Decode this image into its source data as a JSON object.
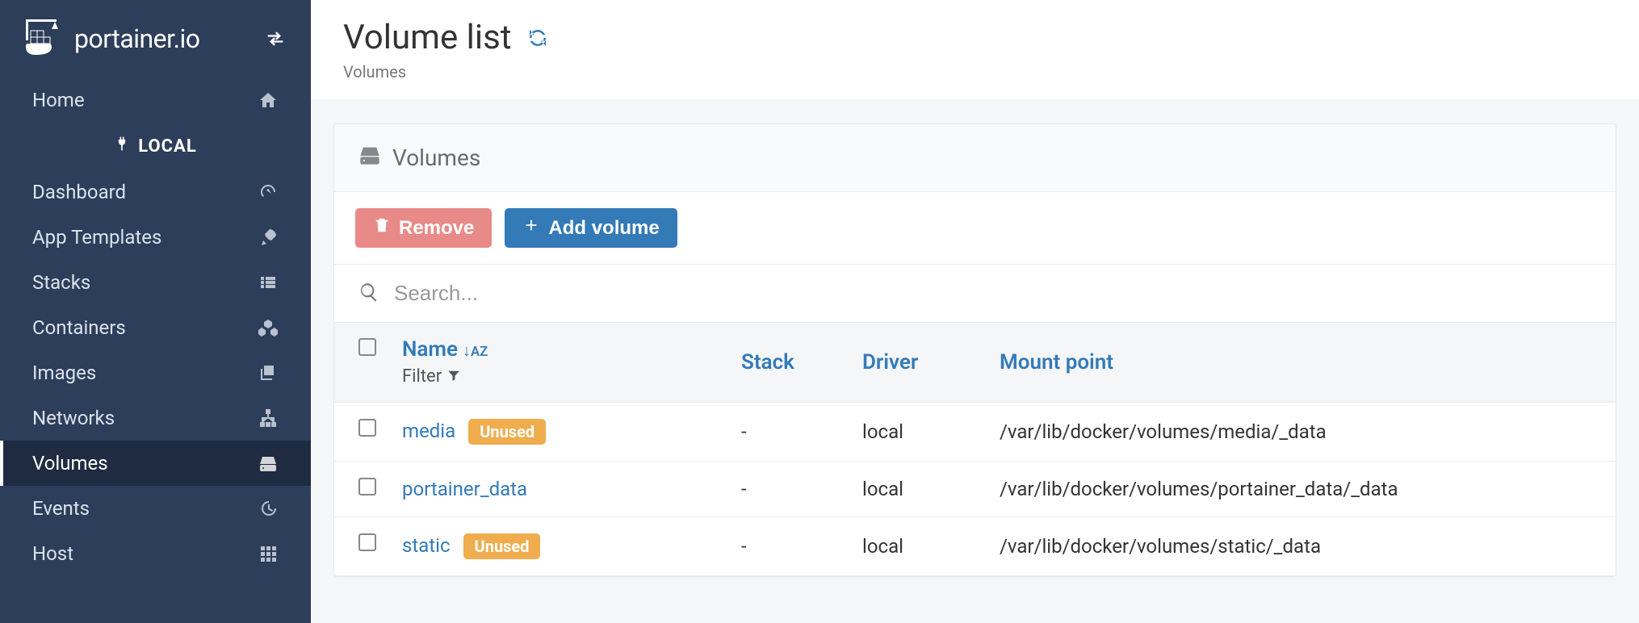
{
  "brand": "portainer.io",
  "sidebar": {
    "header_label": "LOCAL",
    "items": [
      {
        "label": "Home",
        "icon": "home-icon"
      },
      {
        "label": "Dashboard",
        "icon": "dashboard-icon"
      },
      {
        "label": "App Templates",
        "icon": "rocket-icon"
      },
      {
        "label": "Stacks",
        "icon": "list-icon"
      },
      {
        "label": "Containers",
        "icon": "cubes-icon"
      },
      {
        "label": "Images",
        "icon": "clone-icon"
      },
      {
        "label": "Networks",
        "icon": "sitemap-icon"
      },
      {
        "label": "Volumes",
        "icon": "hdd-icon"
      },
      {
        "label": "Events",
        "icon": "history-icon"
      },
      {
        "label": "Host",
        "icon": "th-icon"
      }
    ]
  },
  "page": {
    "title": "Volume list",
    "breadcrumb": "Volumes"
  },
  "card": {
    "title": "Volumes"
  },
  "toolbar": {
    "remove": "Remove",
    "add": "Add volume"
  },
  "search": {
    "placeholder": "Search..."
  },
  "table": {
    "headers": {
      "name": "Name",
      "filter": "Filter",
      "stack": "Stack",
      "driver": "Driver",
      "mount": "Mount point"
    },
    "rows": [
      {
        "name": "media",
        "badge": "Unused",
        "stack": "-",
        "driver": "local",
        "mount": "/var/lib/docker/volumes/media/_data"
      },
      {
        "name": "portainer_data",
        "badge": "",
        "stack": "-",
        "driver": "local",
        "mount": "/var/lib/docker/volumes/portainer_data/_data"
      },
      {
        "name": "static",
        "badge": "Unused",
        "stack": "-",
        "driver": "local",
        "mount": "/var/lib/docker/volumes/static/_data"
      }
    ]
  }
}
